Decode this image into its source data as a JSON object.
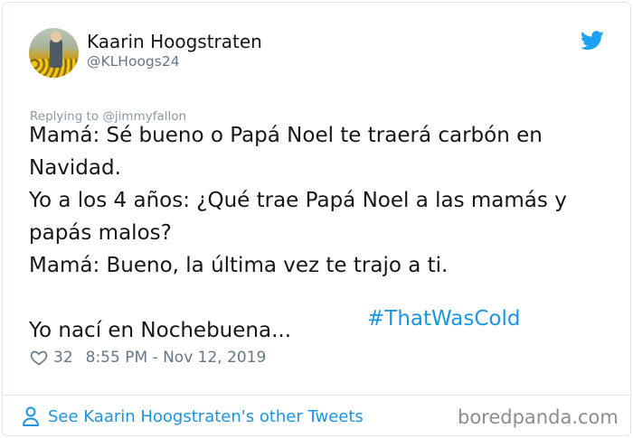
{
  "user": {
    "name": "Kaarin Hoogstraten",
    "handle": "@KLHoogs24"
  },
  "tweet": {
    "reply_to": "Replying to @jimmyfallon",
    "text": "Mamá: Sé bueno o Papá Noel te traerá carbón en\nNavidad.\nYo a los 4 años: ¿Qué trae Papá Noel a las mamás y\npapás malos?\nMamá: Bueno, la última vez te trajo a ti.\n\nYo nací en Nochebuena...",
    "hashtag": "#ThatWasCold",
    "likes": "32",
    "timestamp": "8:55 PM - Nov 12, 2019"
  },
  "footer": {
    "other_tweets_link": "See Kaarin Hoogstraten's other Tweets",
    "watermark": "boredpanda.com"
  },
  "icons": {
    "brand": "twitter-bird-icon",
    "like": "heart-icon",
    "profile": "person-icon"
  },
  "colors": {
    "link_blue": "#1b95e0",
    "twitter_blue": "#1da1f2",
    "muted_text": "#657786",
    "main_text": "#14171a",
    "border": "#e1e8ed"
  }
}
